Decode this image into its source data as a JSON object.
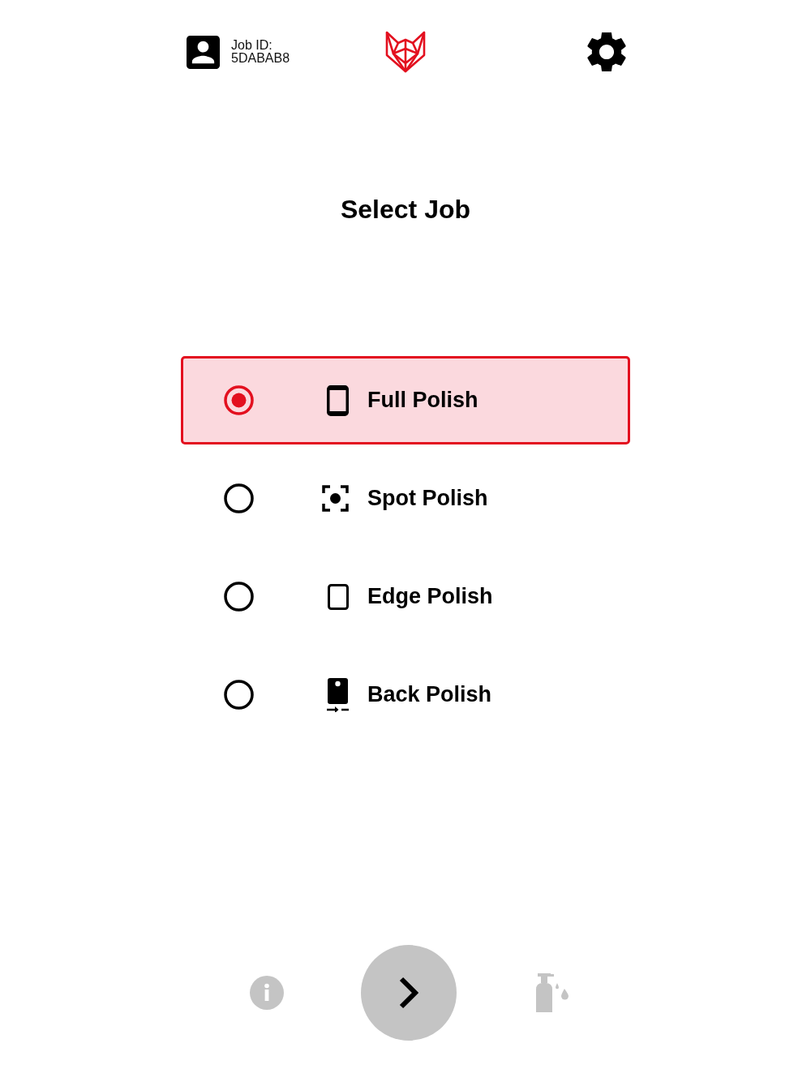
{
  "header": {
    "job_id_label": "Job ID:",
    "job_id": "5DABAB8"
  },
  "title": "Select Job",
  "jobs": [
    {
      "label": "Full Polish",
      "kind": "full",
      "selected": true
    },
    {
      "label": "Spot Polish",
      "kind": "spot",
      "selected": false
    },
    {
      "label": "Edge Polish",
      "kind": "edge",
      "selected": false
    },
    {
      "label": "Back Polish",
      "kind": "back",
      "selected": false
    }
  ]
}
